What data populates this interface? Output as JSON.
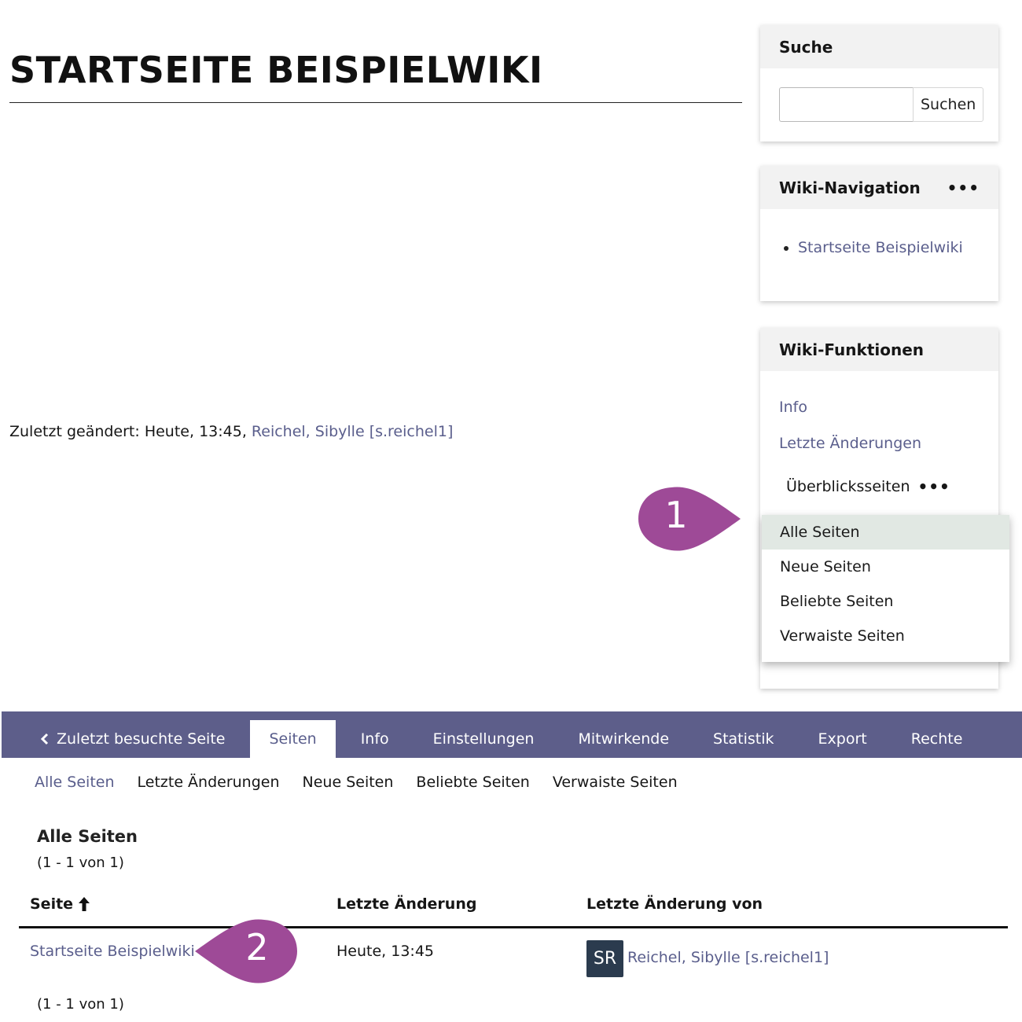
{
  "page": {
    "title": "STARTSEITE BEISPIELWIKI",
    "last_changed_prefix": "Zuletzt geändert: Heute, 13:45,",
    "last_changed_user": "Reichel, Sibylle [s.reichel1]"
  },
  "sidebar": {
    "search": {
      "title": "Suche",
      "input_value": "",
      "button_label": "Suchen"
    },
    "wiki_navigation": {
      "title": "Wiki-Navigation",
      "menu_icon": "more-horizontal-icon",
      "items": [
        {
          "label": "Startseite Beispielwiki"
        }
      ]
    },
    "wiki_functions": {
      "title": "Wiki-Funktionen",
      "items": [
        {
          "label": "Info"
        },
        {
          "label": "Letzte Änderungen"
        }
      ],
      "overview_label": "Überblicksseiten",
      "overview_icon": "more-horizontal-icon",
      "dropdown": [
        {
          "label": "Alle Seiten",
          "active": true
        },
        {
          "label": "Neue Seiten"
        },
        {
          "label": "Beliebte Seiten"
        },
        {
          "label": "Verwaiste Seiten"
        }
      ]
    }
  },
  "callouts": [
    {
      "number": "1"
    },
    {
      "number": "2"
    }
  ],
  "tabbar": {
    "back_label": "Zuletzt besuchte Seite",
    "back_icon": "chevron-left-icon",
    "tabs": [
      {
        "label": "Seiten",
        "active": true
      },
      {
        "label": "Info"
      },
      {
        "label": "Einstellungen"
      },
      {
        "label": "Mitwirkende"
      },
      {
        "label": "Statistik"
      },
      {
        "label": "Export"
      },
      {
        "label": "Rechte"
      }
    ]
  },
  "subtabs": [
    {
      "label": "Alle Seiten",
      "active": true
    },
    {
      "label": "Letzte Änderungen"
    },
    {
      "label": "Neue Seiten"
    },
    {
      "label": "Beliebte Seiten"
    },
    {
      "label": "Verwaiste Seiten"
    }
  ],
  "content": {
    "section_title": "Alle Seiten",
    "range_top": "(1 - 1 von 1)",
    "range_bottom": "(1 - 1 von 1)",
    "table": {
      "headers": [
        "Seite",
        "Letzte Änderung",
        "Letzte Änderung von"
      ],
      "sort_icon": "arrow-up-icon",
      "rows": [
        {
          "page": "Startseite Beispielwiki",
          "changed": "Heute, 13:45",
          "avatar_initials": "SR",
          "user": "Reichel, Sibylle [s.reichel1]"
        }
      ]
    }
  },
  "colors": {
    "accent": "#5d5e8a",
    "link": "#5a5e8c",
    "callout": "#9e4a97",
    "avatar": "#2b3b4e",
    "dropdown_active": "#e1e8e3"
  }
}
